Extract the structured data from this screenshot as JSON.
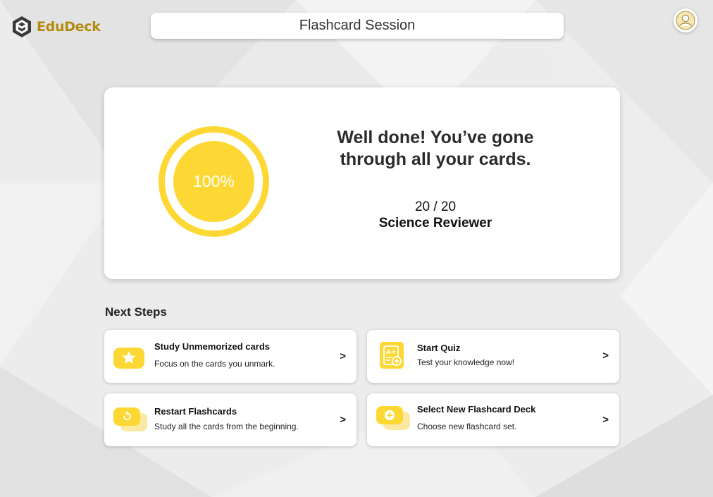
{
  "app": {
    "name": "EduDeck"
  },
  "header": {
    "title": "Flashcard Session"
  },
  "icons": {
    "logo": "hexagon-logo-icon",
    "avatar": "user-avatar-icon",
    "star": "star-icon",
    "restart": "restart-icon",
    "quiz": "quiz-icon",
    "add": "add-deck-icon"
  },
  "colors": {
    "accent": "#fdd835",
    "brand": "#b48a0e"
  },
  "result": {
    "percent_label": "100%",
    "progress_fraction": 1.0,
    "message": "Well done! You’ve gone through all your cards.",
    "count": "20 / 20",
    "deck_name": "Science Reviewer"
  },
  "next_steps": {
    "title": "Next Steps",
    "items": [
      {
        "title": "Study Unmemorized cards",
        "desc": "Focus on the cards you unmark.",
        "arrow": ">"
      },
      {
        "title": "Start Quiz",
        "desc": "Test your knowledge now!",
        "arrow": ">"
      },
      {
        "title": "Restart Flashcards",
        "desc": "Study all the cards from the beginning.",
        "arrow": ">"
      },
      {
        "title": "Select New Flashcard Deck",
        "desc": "Choose new flashcard set.",
        "arrow": ">"
      }
    ]
  }
}
